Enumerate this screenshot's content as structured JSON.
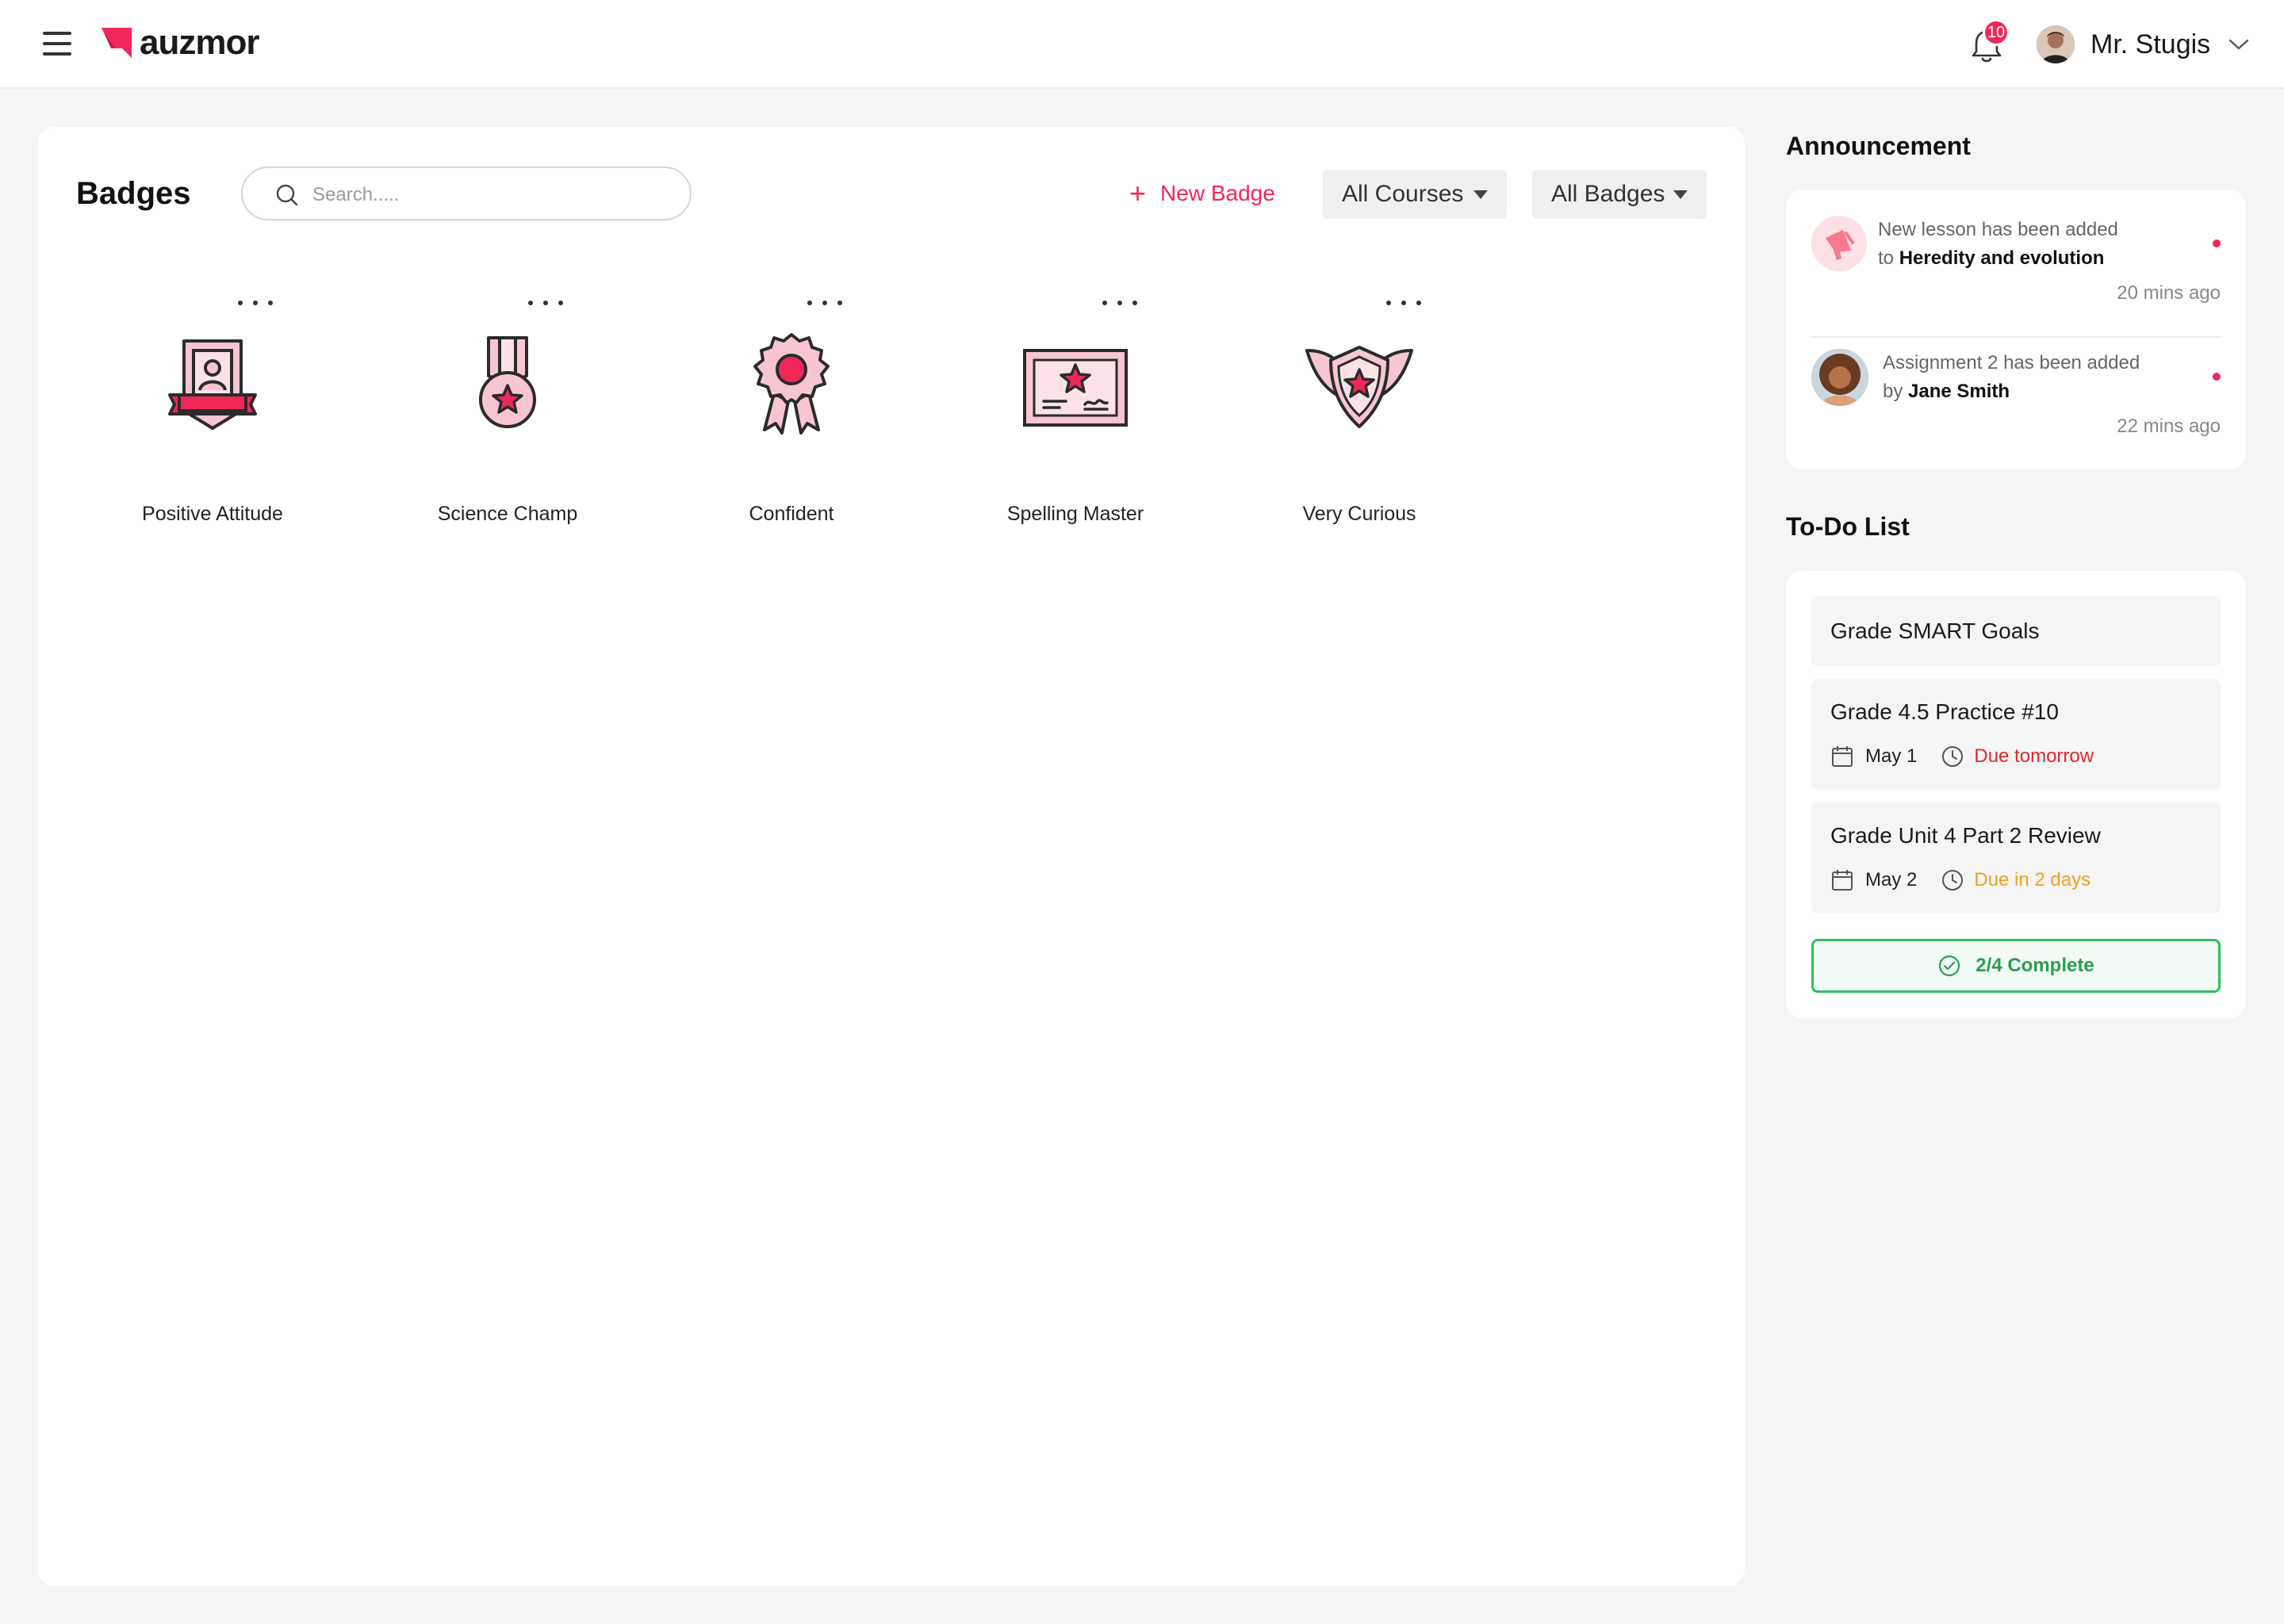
{
  "header": {
    "brand": "auzmor",
    "notification_count": "10",
    "user_name": "Mr. Stugis"
  },
  "main": {
    "title": "Badges",
    "search_placeholder": "Search.....",
    "new_badge_label": "New Badge",
    "filter_courses": "All Courses",
    "filter_badges": "All Badges",
    "badges": [
      {
        "label": "Positive Attitude",
        "icon": "certificate-person-icon"
      },
      {
        "label": "Science Champ",
        "icon": "medal-star-icon"
      },
      {
        "label": "Confident",
        "icon": "rosette-icon"
      },
      {
        "label": "Spelling Master",
        "icon": "diploma-star-icon"
      },
      {
        "label": "Very Curious",
        "icon": "winged-shield-icon"
      }
    ]
  },
  "announcement": {
    "title": "Announcement",
    "items": [
      {
        "line1": "New lesson has been added",
        "prefix": "to",
        "bold": "Heredity and evolution",
        "time": "20 mins ago",
        "icon": "megaphone-icon"
      },
      {
        "line1": "Assignment 2 has been added",
        "prefix": "by",
        "bold": "Jane Smith",
        "time": "22 mins ago",
        "icon": "avatar"
      }
    ]
  },
  "todo": {
    "title": "To-Do List",
    "items": [
      {
        "name": "Grade SMART Goals"
      },
      {
        "name": "Grade 4.5 Practice #10",
        "date": "May 1",
        "due": "Due tomorrow",
        "due_color": "#e0282e"
      },
      {
        "name": "Grade Unit 4 Part 2 Review",
        "date": "May 2",
        "due": "Due in 2 days",
        "due_color": "#f0a020"
      }
    ],
    "complete_label": "2/4 Complete"
  },
  "colors": {
    "accent": "#f0285a",
    "badge_fill": "#f7c6d2",
    "success": "#2fbf5e"
  }
}
